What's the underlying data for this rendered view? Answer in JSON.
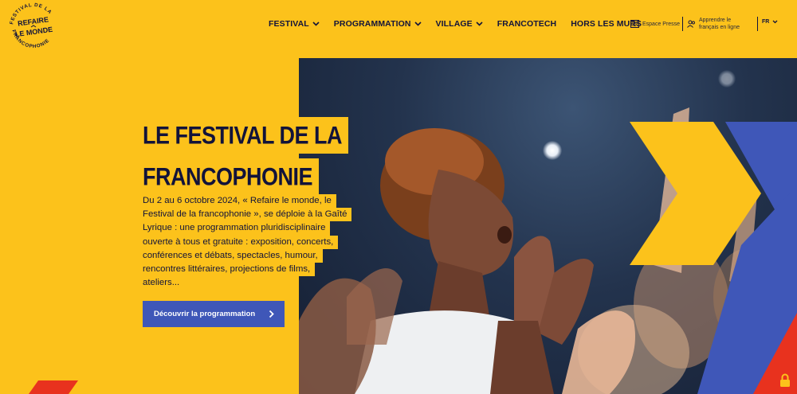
{
  "logo": {
    "top_arc": "FESTIVAL DE LA",
    "bottom_arc": "FRANCOPHONIE",
    "word1": "REFAIRE",
    "word2": "LE MONDE"
  },
  "nav": {
    "items": [
      {
        "label": "FESTIVAL",
        "has_dropdown": true
      },
      {
        "label": "PROGRAMMATION",
        "has_dropdown": true
      },
      {
        "label": "VILLAGE",
        "has_dropdown": true
      },
      {
        "label": "FRANCOTECH",
        "has_dropdown": false
      },
      {
        "label": "HORS LES MURS",
        "has_dropdown": false
      }
    ]
  },
  "utility": {
    "press_label": "Espace Presse",
    "learn_line1": "Apprendre le",
    "learn_line2": "français en ligne",
    "lang": "FR"
  },
  "hero": {
    "title_line1": "LE FESTIVAL DE LA",
    "title_line2": "FRANCOPHONIE",
    "description_lines": [
      "Du 2 au 6 octobre 2024, « Refaire le monde, le",
      "Festival de la francophonie », se déploie à la Gaîté",
      "Lyrique : une programmation pluridisciplinaire",
      "ouverte à tous et gratuite : exposition, concerts,",
      "conférences et débats, spectacles, humour,",
      "rencontres littéraires, projections de films,",
      "ateliers..."
    ],
    "cta_label": "Découvrir la programmation"
  },
  "colors": {
    "background": "#fcc21b",
    "navy": "#12133a",
    "blue": "#3f57b8",
    "red": "#e8321e"
  },
  "icons": {
    "press": "newspaper-icon",
    "learn": "people-icon",
    "chevron": "chevron-down-icon",
    "cta_arrow": "chevron-right-icon",
    "lock": "lock-icon"
  }
}
